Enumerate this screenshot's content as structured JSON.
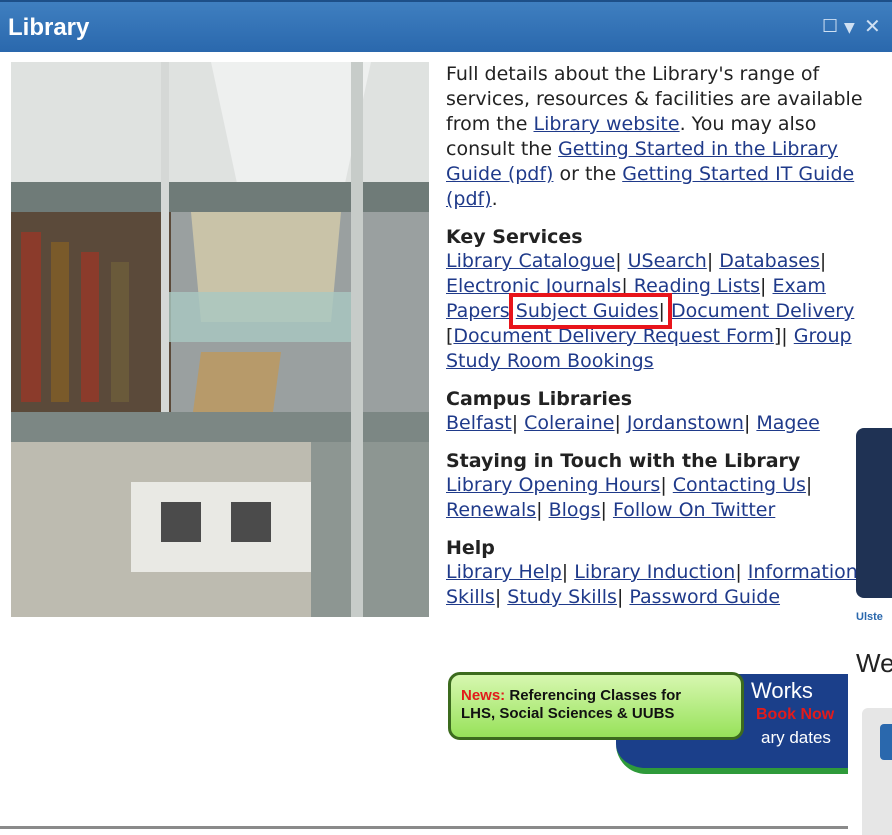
{
  "window": {
    "title": "Library"
  },
  "intro": {
    "p1": "Full details about the Library's range of services, resources & facilities are available from the ",
    "link_website": "Library website",
    "p2": ". You may also consult the ",
    "link_getting_started_library": "Getting Started in the Library Guide (pdf)",
    "p3": " or the ",
    "link_getting_started_it": "Getting Started IT Guide (pdf)",
    "p4": "."
  },
  "key_services": {
    "heading": "Key Services",
    "items": [
      "Library Catalogue",
      "USearch",
      "Databases",
      "Electronic Journals",
      "Reading Lists",
      "Exam Papers",
      "Subject Guides",
      "Document Delivery",
      "Document Delivery Request Form",
      "Group Study Room Bookings"
    ]
  },
  "campus": {
    "heading": "Campus Libraries",
    "items": [
      "Belfast",
      "Coleraine",
      "Jordanstown",
      "Magee"
    ]
  },
  "touch": {
    "heading": "Staying in Touch with the Library",
    "items": [
      "Library Opening Hours",
      "Contacting Us",
      "Renewals",
      "Blogs",
      "Follow On Twitter"
    ]
  },
  "help": {
    "heading": "Help",
    "items": [
      "Library Help",
      "Library Induction",
      "Information Skills",
      "Study Skills",
      "Password Guide"
    ]
  },
  "banner": {
    "news": "News:",
    "text1": " Referencing Classes for",
    "text2": "LHS, Social Sciences & UUBS",
    "behind1": "Works",
    "behind2": "Book Now",
    "behind3": "ary dates"
  },
  "right": {
    "ulster": "Ulste",
    "we": "We"
  },
  "colors": {
    "titlebar": "#2a68ad",
    "link": "#1f3a8a",
    "highlight": "#e8141b"
  }
}
